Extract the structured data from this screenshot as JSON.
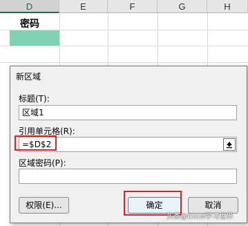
{
  "sheet": {
    "columns": [
      {
        "label": "D",
        "active": true
      },
      {
        "label": "E",
        "active": false
      },
      {
        "label": "F",
        "active": false
      },
      {
        "label": "G",
        "active": false
      },
      {
        "label": "H",
        "active": false
      }
    ],
    "cell_d1": "密码",
    "cell_d2_fill": "#7fd3b2"
  },
  "dialog": {
    "title": "新区域",
    "title_label": "标题(T):",
    "title_value": "区域1",
    "refers_label": "引用单元格(R):",
    "refers_value": "=$D$2",
    "password_label": "区域密码(P):",
    "password_value": "",
    "permissions_button": "权限(E)...",
    "ok_button": "确定",
    "cancel_button": "取消",
    "collapse_icon": "collapse-up-arrow-icon"
  },
  "highlight_color": "#e02020",
  "watermark": "头条@Excel学习世界"
}
